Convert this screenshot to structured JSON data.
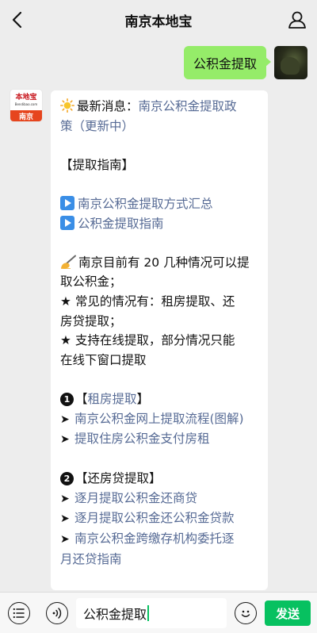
{
  "header": {
    "title": "南京本地宝",
    "back_icon": "chevron-left-icon",
    "profile_icon": "user-icon"
  },
  "outgoing_message": {
    "text": "公积金提取",
    "bubble_color": "#95ec69"
  },
  "bot_avatar": {
    "logo_text": "本地宝",
    "logo_sub": "Bendibao.com",
    "city": "南京"
  },
  "incoming_message": {
    "latest_label": "最新消息：",
    "latest_link_line1": "南京公积金提取政",
    "latest_link_line2": "策（更新中）",
    "guide_heading": "【提取指南】",
    "guide_links": [
      "南京公积金提取方式汇总",
      "公积金提取指南"
    ],
    "info_line1": "南京目前有 20 几种情况可以提",
    "info_line2": "取公积金；",
    "info_line3": "★ 常见的情况有：租房提取、还",
    "info_line4": "房贷提取；",
    "info_line5": "★ 支持在线提取，部分情况只能",
    "info_line6": "在线下窗口提取",
    "section1": {
      "num": "1",
      "bracket_open": "【",
      "title_link": "租房提取",
      "bracket_close": "】",
      "items": [
        "南京公积金网上提取流程(图解)",
        "提取住房公积金支付房租"
      ]
    },
    "section2": {
      "num": "2",
      "title": "【还房贷提取】",
      "items": [
        "逐月提取公积金还商贷",
        "逐月提取公积金还公积金贷款"
      ],
      "item3_line1": "南京公积金跨缴存机构委托逐",
      "item3_line2": "月还贷指南"
    },
    "link_color": "#576b95"
  },
  "input_bar": {
    "value": "公积金提取",
    "send_label": "发送",
    "send_color": "#07c160",
    "menu_icon": "menu-icon",
    "voice_icon": "voice-icon",
    "emoji_icon": "emoji-icon"
  }
}
